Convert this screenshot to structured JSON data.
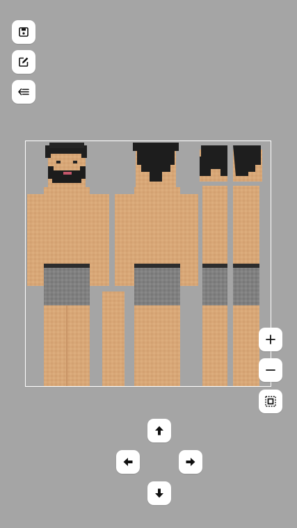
{
  "toolbar": {
    "save_icon": "floppy-disk-icon",
    "edit_icon": "edit-pencil-icon",
    "back_icon": "collapse-menu-icon"
  },
  "zoom": {
    "zoom_in_icon": "plus-icon",
    "zoom_out_icon": "minus-icon",
    "fit_icon": "fit-frame-icon"
  },
  "dpad": {
    "up_icon": "arrow-up-icon",
    "left_icon": "arrow-left-icon",
    "right_icon": "arrow-right-icon",
    "down_icon": "arrow-down-icon"
  },
  "canvas": {
    "content": "skin-texture-preview"
  },
  "colors": {
    "background": "#a5a5a5",
    "button": "#ffffff",
    "skin": "#d9a878",
    "skin_shade": "#c9956a",
    "hair": "#202020",
    "shorts": "#7f7f7f",
    "waistband": "#2e2e2e",
    "frame": "#ffffff"
  }
}
